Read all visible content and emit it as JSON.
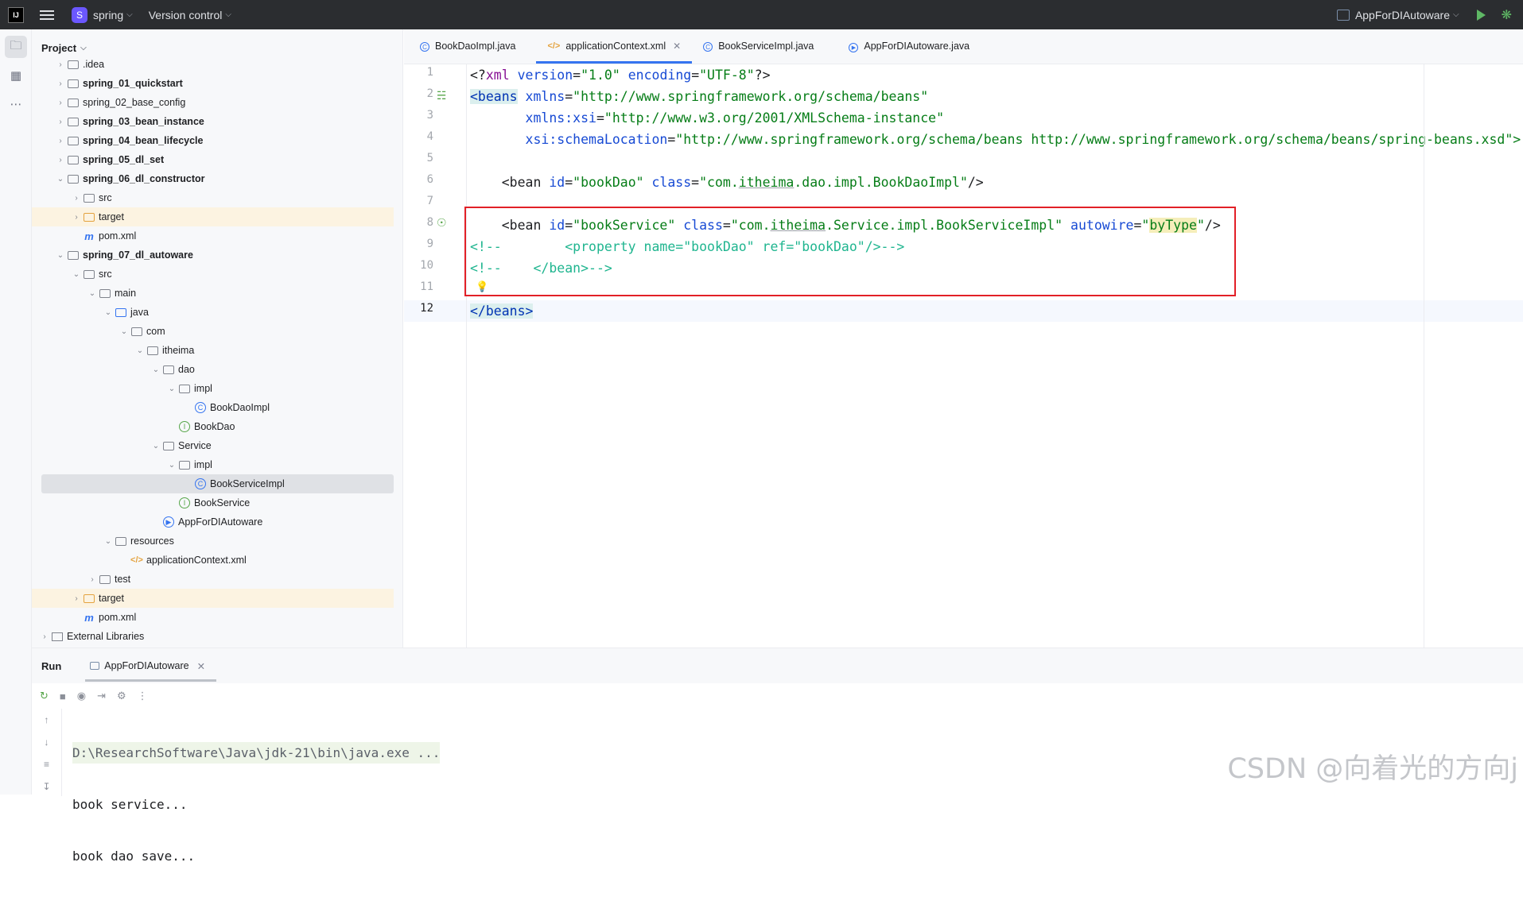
{
  "titlebar": {
    "logo": "IJ",
    "project_badge": "S",
    "project_name": "spring",
    "vcs_label": "Version control",
    "run_config": "AppForDIAutoware"
  },
  "project_panel": {
    "title": "Project",
    "items": [
      {
        "label": ".idea",
        "icon": "folder-icon"
      },
      {
        "label": "spring_01_quickstart",
        "icon": "folder-icon",
        "bold": true
      },
      {
        "label": "spring_02_base_config",
        "icon": "folder-icon"
      },
      {
        "label": "spring_03_bean_instance",
        "icon": "folder-icon",
        "bold": true
      },
      {
        "label": "spring_04_bean_lifecycle",
        "icon": "folder-icon",
        "bold": true
      },
      {
        "label": "spring_05_dl_set",
        "icon": "folder-icon",
        "bold": true
      },
      {
        "label": "spring_06_dl_constructor",
        "icon": "folder-icon",
        "bold": true
      },
      {
        "label": "src",
        "icon": "folder-icon"
      },
      {
        "label": "target",
        "icon": "folder-icon"
      },
      {
        "label": "pom.xml",
        "icon": "maven-icon"
      },
      {
        "label": "spring_07_dl_autoware",
        "icon": "folder-icon",
        "bold": true
      },
      {
        "label": "src",
        "icon": "folder-icon"
      },
      {
        "label": "main",
        "icon": "folder-icon"
      },
      {
        "label": "java",
        "icon": "folder-icon"
      },
      {
        "label": "com",
        "icon": "package-icon"
      },
      {
        "label": "itheima",
        "icon": "package-icon"
      },
      {
        "label": "dao",
        "icon": "package-icon"
      },
      {
        "label": "impl",
        "icon": "package-icon"
      },
      {
        "label": "BookDaoImpl",
        "icon": "class-icon"
      },
      {
        "label": "BookDao",
        "icon": "interface-icon"
      },
      {
        "label": "Service",
        "icon": "package-icon"
      },
      {
        "label": "impl",
        "icon": "package-icon"
      },
      {
        "label": "BookServiceImpl",
        "icon": "class-icon"
      },
      {
        "label": "BookService",
        "icon": "interface-icon"
      },
      {
        "label": "AppForDIAutoware",
        "icon": "app-class-icon"
      },
      {
        "label": "resources",
        "icon": "folder-icon"
      },
      {
        "label": "applicationContext.xml",
        "icon": "xml-icon"
      },
      {
        "label": "test",
        "icon": "folder-icon"
      },
      {
        "label": "target",
        "icon": "folder-icon"
      },
      {
        "label": "pom.xml",
        "icon": "maven-icon"
      },
      {
        "label": "External Libraries",
        "icon": "library-icon"
      }
    ]
  },
  "tabs": [
    {
      "label": "BookDaoImpl.java",
      "icon": "class-icon"
    },
    {
      "label": "applicationContext.xml",
      "icon": "xml-icon",
      "active": true
    },
    {
      "label": "BookServiceImpl.java",
      "icon": "class-icon"
    },
    {
      "label": "AppForDIAutoware.java",
      "icon": "app-class-icon"
    }
  ],
  "editor": {
    "line_numbers": [
      "1",
      "2",
      "3",
      "4",
      "5",
      "6",
      "7",
      "8",
      "9",
      "10",
      "11",
      "12"
    ],
    "lines": {
      "l1": {
        "a": "<?",
        "b": "xml",
        "c": " version",
        "d": "=",
        "e": "\"1.0\"",
        "f": " encoding",
        "g": "=",
        "h": "\"UTF-8\"",
        "i": "?>"
      },
      "l2": {
        "a": "<beans",
        "b": " xmlns",
        "c": "=",
        "d": "\"http://www.springframework.org/schema/beans\""
      },
      "l3": {
        "a": "       xmlns:xsi",
        "b": "=",
        "c": "\"http://www.w3.org/2001/XMLSchema-instance\""
      },
      "l4": {
        "a": "       xsi",
        "b": ":schemaLocation",
        "c": "=",
        "d": "\"http://www.springframework.org/schema/beans http://www.springframework.org/schema/beans/spring-beans.xsd\">"
      },
      "l6": {
        "a": "    <bean",
        "b": " id",
        "c": "=",
        "d": "\"bookDao\"",
        "e": " class",
        "f": "=",
        "g": "\"com.",
        "h": "itheima",
        "i": ".dao.impl.BookDaoImpl\"",
        "j": "/>"
      },
      "l8": {
        "a": "    <bean",
        "b": " id",
        "c": "=",
        "d": "\"bookService\"",
        "e": " class",
        "f": "=",
        "g": "\"com.",
        "h": "itheima",
        "i": ".Service.impl.BookServiceImpl\"",
        "j": " autowire",
        "k": "=",
        "l": "\"",
        "m": "byType",
        "n": "\"",
        "o": "/>"
      },
      "l9": "<!--        <property name=\"bookDao\" ref=\"bookDao\"/>-->",
      "l10": "<!--    </bean>-->",
      "l12": "</beans>"
    }
  },
  "run": {
    "title": "Run",
    "tab_label": "AppForDIAutoware",
    "output": [
      "D:\\ResearchSoftware\\Java\\jdk-21\\bin\\java.exe ...",
      "book service...",
      "book dao save..."
    ]
  },
  "watermark": "CSDN @向着光的方向j"
}
